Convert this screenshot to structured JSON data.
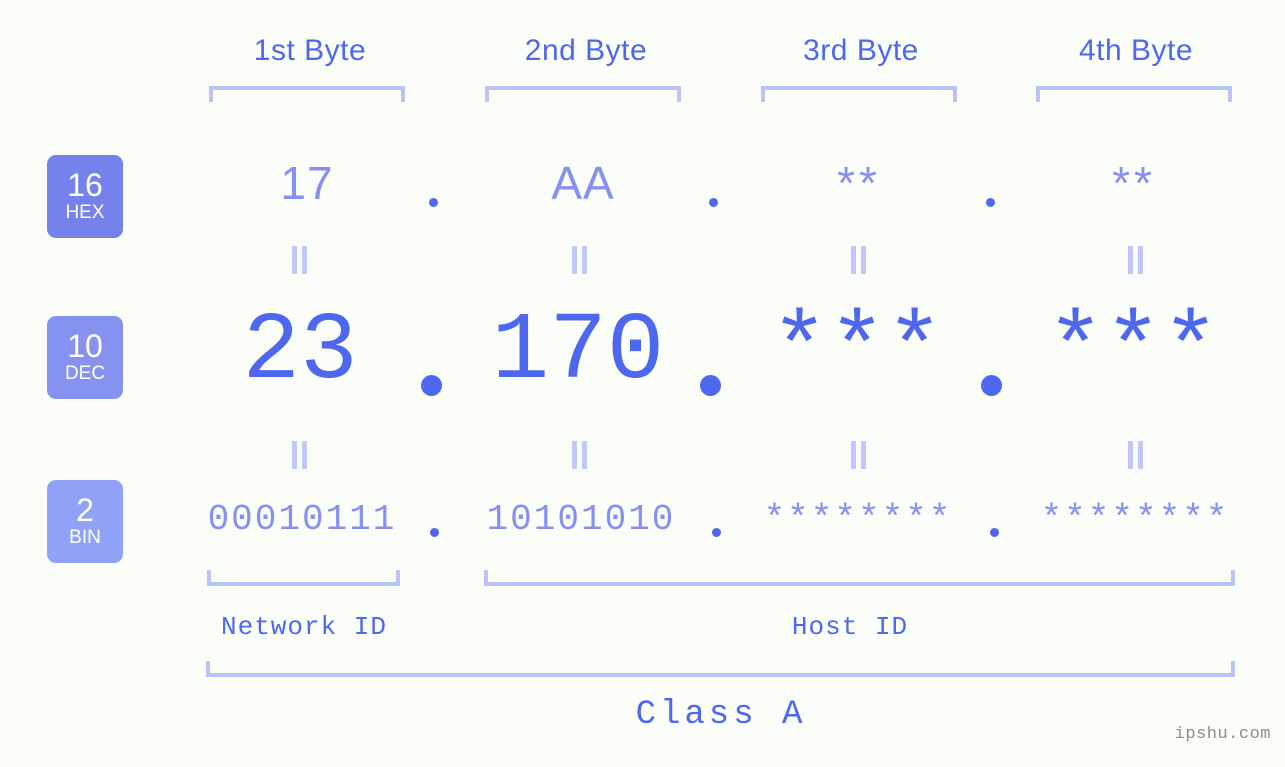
{
  "background_color": "#fbfdf8",
  "accent_strong": "#4d68ee",
  "accent_mid": "#8690f2",
  "accent_light": "#b9c2f9",
  "headers": [
    {
      "label": "1st Byte"
    },
    {
      "label": "2nd Byte"
    },
    {
      "label": "3rd Byte"
    },
    {
      "label": "4th Byte"
    }
  ],
  "radix_badges": [
    {
      "number": "16",
      "name": "HEX",
      "color": "#7682ec"
    },
    {
      "number": "10",
      "name": "DEC",
      "color": "#8692f0"
    },
    {
      "number": "2",
      "name": "BIN",
      "color": "#90a2f8"
    }
  ],
  "rows": {
    "hex": {
      "values": [
        "17",
        "AA",
        "**",
        "**"
      ]
    },
    "dec": {
      "values": [
        "23",
        "170",
        "***",
        "***"
      ]
    },
    "bin": {
      "values": [
        "00010111",
        "10101010",
        "********",
        "********"
      ]
    }
  },
  "separators": {
    "hex": [
      ".",
      ".",
      "."
    ],
    "dec": [
      ".",
      ".",
      "."
    ],
    "bin": [
      ".",
      ".",
      "."
    ]
  },
  "equals_marks": {
    "symbol": "="
  },
  "footer": {
    "network_id": "Network ID",
    "host_id": "Host ID",
    "class": "Class A"
  },
  "watermark": "ipshu.com"
}
